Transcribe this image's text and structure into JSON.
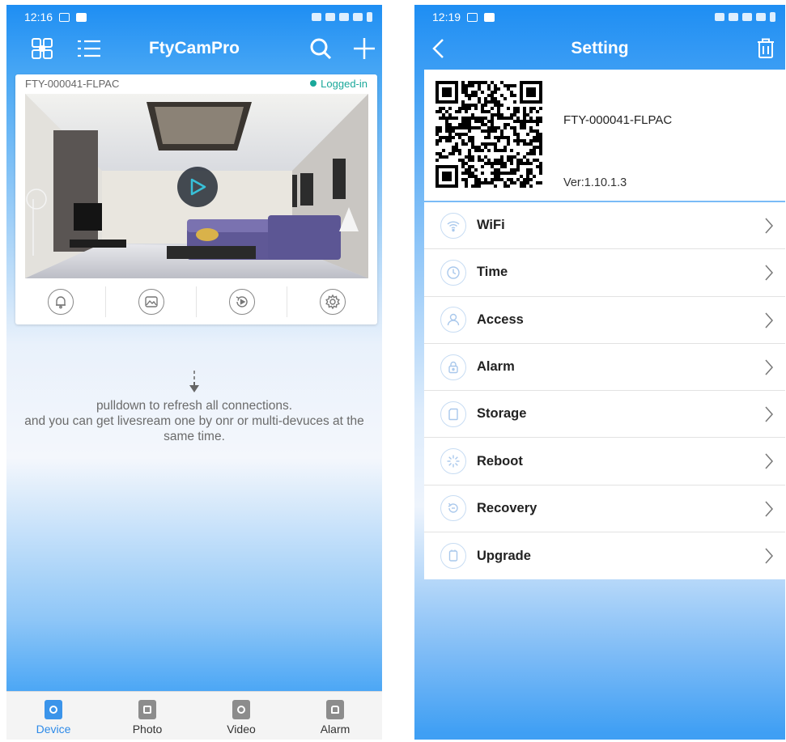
{
  "left": {
    "status_time": "12:16",
    "app_title": "FtyCamPro",
    "device": {
      "id": "FTY-000041-FLPAC",
      "status": "Logged-in"
    },
    "hint": {
      "line1": "pulldown to refresh all connections.",
      "line2": "and you can get livesream one by onr or multi-devuces at the",
      "line3": "same time."
    },
    "tabs": [
      {
        "label": "Device",
        "icon": "camera-device-icon"
      },
      {
        "label": "Photo",
        "icon": "photo-icon"
      },
      {
        "label": "Video",
        "icon": "video-icon"
      },
      {
        "label": "Alarm",
        "icon": "alarm-icon"
      }
    ],
    "active_tab": "Device"
  },
  "right": {
    "status_time": "12:19",
    "title": "Setting",
    "device_id": "FTY-000041-FLPAC",
    "version": "Ver:1.10.1.3",
    "menu": [
      {
        "label": "WiFi",
        "icon": "wifi-icon"
      },
      {
        "label": "Time",
        "icon": "clock-icon"
      },
      {
        "label": "Access",
        "icon": "user-icon"
      },
      {
        "label": "Alarm",
        "icon": "alarm-lock-icon"
      },
      {
        "label": "Storage",
        "icon": "sd-card-icon"
      },
      {
        "label": "Reboot",
        "icon": "reboot-icon"
      },
      {
        "label": "Recovery",
        "icon": "recovery-icon"
      },
      {
        "label": "Upgrade",
        "icon": "upgrade-icon"
      }
    ]
  },
  "colors": {
    "brand_blue": "#1e8ef3",
    "online_green": "#1aa89a",
    "active_tab": "#2d8ae8"
  }
}
